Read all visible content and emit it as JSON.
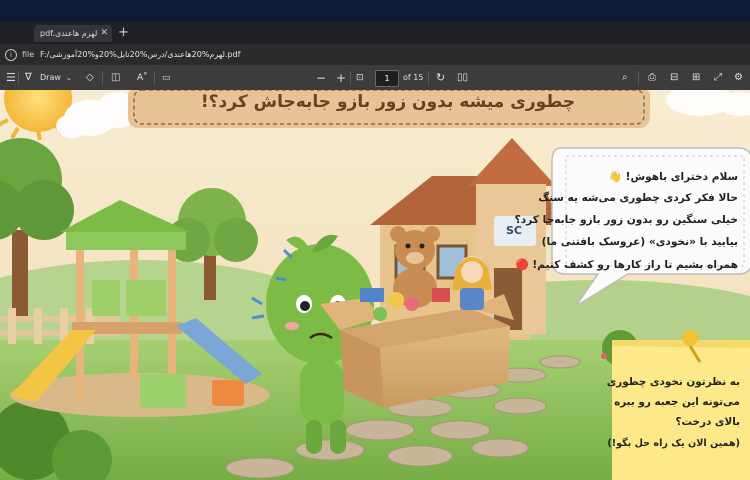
{
  "browser": {
    "tab_title": "pdf.لهرم هاعندی",
    "address_scheme": "file",
    "address_url": "F:/لهرم%20هاعندی/درس%20تابل%20و%20آموزشی.pdf"
  },
  "pdf_toolbar": {
    "draw_label": "Draw",
    "zoom_minus": "−",
    "zoom_plus": "+",
    "current_page": "1",
    "page_total": "of 15"
  },
  "slide": {
    "title": "چطوری میشه بدون زور بازو جابه‌جاش کرد؟!",
    "school_sign": "SC",
    "bubble_lines": [
      "سلام دخترای باهوش! 👋",
      "حالا فکر کردی چطوری می‌شه یه سنگ",
      "خیلی سنگین رو بدون زور بازو جابه‌جا کرد؟",
      "بیایید با «نخودی» (عروسک بافتنی ما)",
      "همراه بشیم تا راز کارها رو کشف کنیم! 🔴"
    ],
    "sticky_lines": [
      "به نظرتون نخودی چطوری",
      "می‌تونه این جعبه رو ببره",
      "بالای درخت؟",
      "(همین الان یک راه حل بگو!)"
    ]
  },
  "colors": {
    "sky_top": "#f7e7c9",
    "grass": "#8fc25d",
    "character": "#7dbb47",
    "sticky": "#fde98a",
    "banner": "#e9c69a",
    "toolbar": "#3c3c3c"
  }
}
